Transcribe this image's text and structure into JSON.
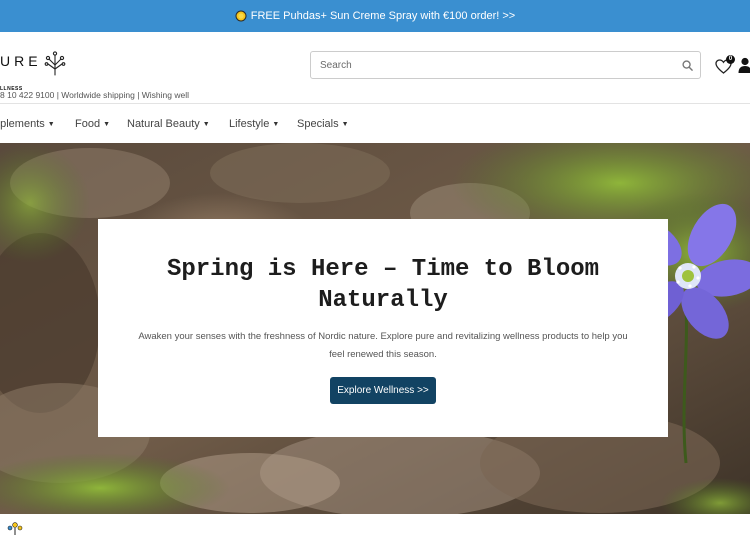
{
  "announcement": {
    "text": "FREE Puhdas+ Sun Creme Spray with €100 order! >>",
    "icon": "sun-icon"
  },
  "header": {
    "logo_text": "URE",
    "logo_subtext": "LLNESS",
    "search_placeholder": "Search",
    "wishlist_count": "0",
    "contact_line": "8 10 422 9100 | Worldwide shipping | Wishing well"
  },
  "nav": {
    "items": [
      {
        "label": "pplements"
      },
      {
        "label": "Food"
      },
      {
        "label": "Natural Beauty"
      },
      {
        "label": "Lifestyle"
      },
      {
        "label": "Specials"
      }
    ]
  },
  "hero": {
    "title": "Spring is Here – Time to Bloom Naturally",
    "description": "Awaken your senses with the freshness of Nordic nature. Explore pure and revitalizing wellness products to help you feel renewed this season.",
    "button_label": "Explore Wellness >>"
  },
  "colors": {
    "announcement_bg": "#3a8fd0",
    "button_bg": "#124363",
    "flower": "#7b6fe0"
  }
}
